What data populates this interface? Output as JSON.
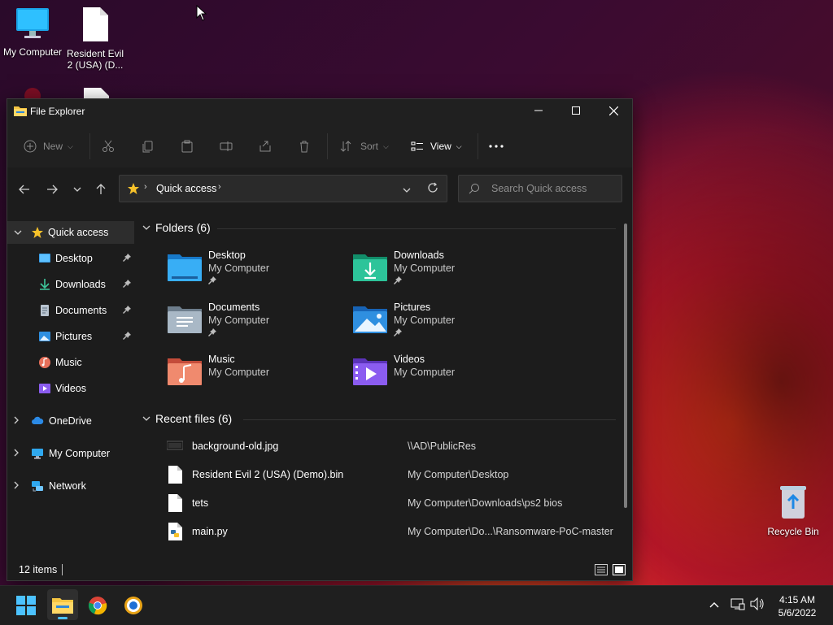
{
  "desktop": {
    "icons": [
      {
        "label": "My Computer"
      },
      {
        "label": "Resident Evil 2 (USA) (D..."
      },
      {
        "label": "Recycle Bin"
      }
    ]
  },
  "window": {
    "title": "File Explorer",
    "toolbar": {
      "new_label": "New",
      "sort_label": "Sort",
      "view_label": "View"
    },
    "address": {
      "crumb": "Quick access"
    },
    "search": {
      "placeholder": "Search Quick access"
    },
    "sidebar": {
      "items": [
        {
          "label": "Quick access"
        },
        {
          "label": "Desktop"
        },
        {
          "label": "Downloads"
        },
        {
          "label": "Documents"
        },
        {
          "label": "Pictures"
        },
        {
          "label": "Music"
        },
        {
          "label": "Videos"
        },
        {
          "label": "OneDrive"
        },
        {
          "label": "My Computer"
        },
        {
          "label": "Network"
        }
      ]
    },
    "folders_header": "Folders (6)",
    "folders": [
      {
        "name": "Desktop",
        "location": "My Computer"
      },
      {
        "name": "Downloads",
        "location": "My Computer"
      },
      {
        "name": "Documents",
        "location": "My Computer"
      },
      {
        "name": "Pictures",
        "location": "My Computer"
      },
      {
        "name": "Music",
        "location": "My Computer"
      },
      {
        "name": "Videos",
        "location": "My Computer"
      }
    ],
    "recent_header": "Recent files (6)",
    "recent": [
      {
        "name": "background-old.jpg",
        "path": "\\\\AD\\PublicRes"
      },
      {
        "name": "Resident Evil 2 (USA) (Demo).bin",
        "path": "My Computer\\Desktop"
      },
      {
        "name": "tets",
        "path": "My Computer\\Downloads\\ps2 bios"
      },
      {
        "name": "main.py",
        "path": "My Computer\\Do...\\Ransomware-PoC-master"
      }
    ],
    "status": {
      "count": "12 items"
    }
  },
  "taskbar": {
    "time": "4:15 AM",
    "date": "5/6/2022"
  },
  "colors": {
    "window_bg": "#1c1c1c",
    "selected": "#2d2d2d",
    "accent_blue": "#4cc2ff"
  }
}
